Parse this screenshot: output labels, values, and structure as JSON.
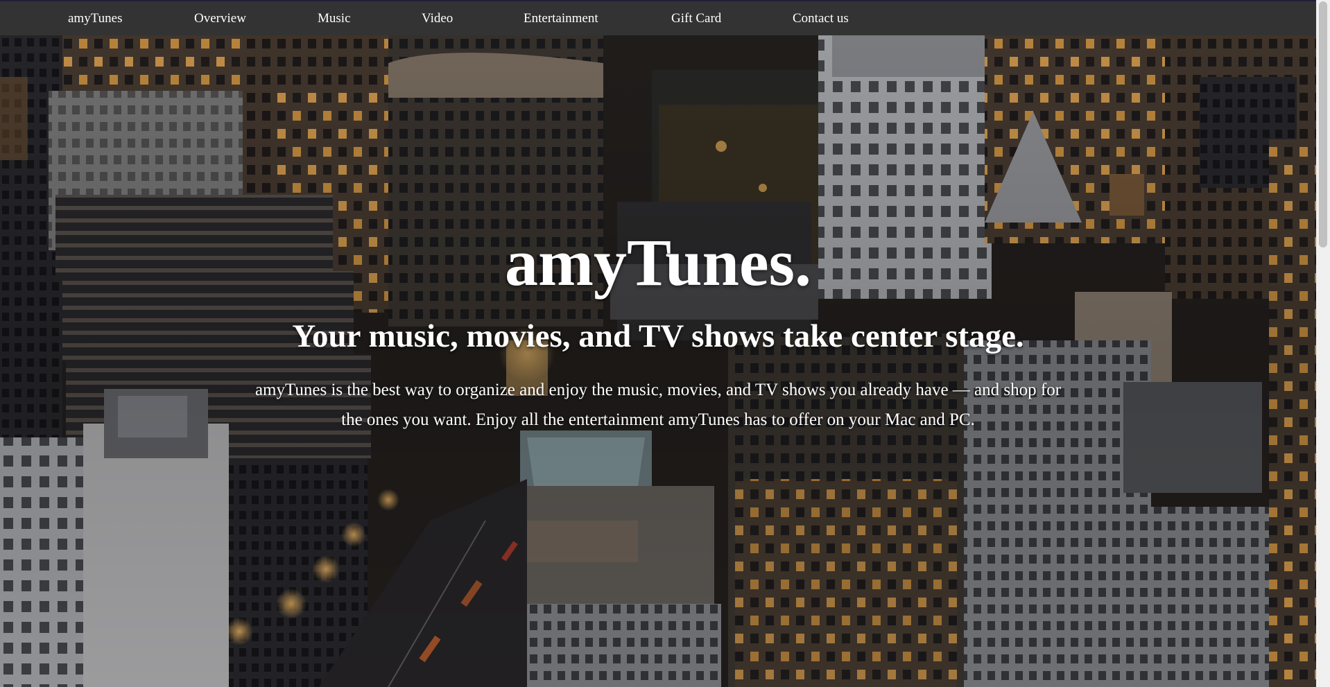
{
  "nav": {
    "brand": "amyTunes",
    "items": [
      {
        "label": "Overview"
      },
      {
        "label": "Music"
      },
      {
        "label": "Video"
      },
      {
        "label": "Entertainment"
      },
      {
        "label": "Gift Card"
      },
      {
        "label": "Contact us"
      }
    ]
  },
  "hero": {
    "title": "amyTunes.",
    "subtitle": "Your music, movies, and TV shows take center stage.",
    "body": "amyTunes is the best way to organize and enjoy the music, movies, and TV shows you already have — and shop for the ones you want. Enjoy all the entertainment amyTunes has to offer on your Mac and PC.",
    "background_image": "night city skyline aerial view"
  },
  "colors": {
    "nav_background": "#333333",
    "nav_text": "#ffffff",
    "hero_text": "#ffffff"
  }
}
